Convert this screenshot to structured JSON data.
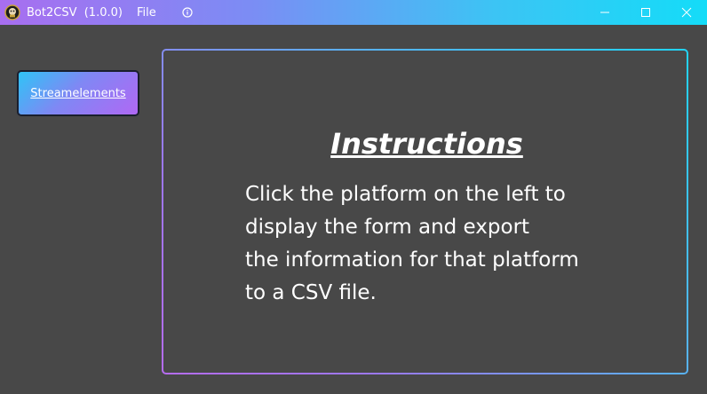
{
  "window": {
    "title": "Bot2CSV  (1.0.0)",
    "menu": {
      "file_label": "File"
    }
  },
  "sidebar": {
    "items": [
      {
        "label": "Streamelements"
      }
    ]
  },
  "instructions": {
    "title": "Instructions",
    "lines": [
      "Click the platform on the left to",
      "display the form and export",
      "the information for that platform",
      "to a CSV file."
    ]
  },
  "colors": {
    "titlebar_start": "#a86ef0",
    "titlebar_end": "#14dcf8",
    "background": "#484848",
    "text": "#ffffff"
  },
  "icons": {
    "app": "app-logo-icon",
    "info": "info-icon",
    "minimize": "minimize-icon",
    "maximize": "maximize-icon",
    "close": "close-icon"
  }
}
